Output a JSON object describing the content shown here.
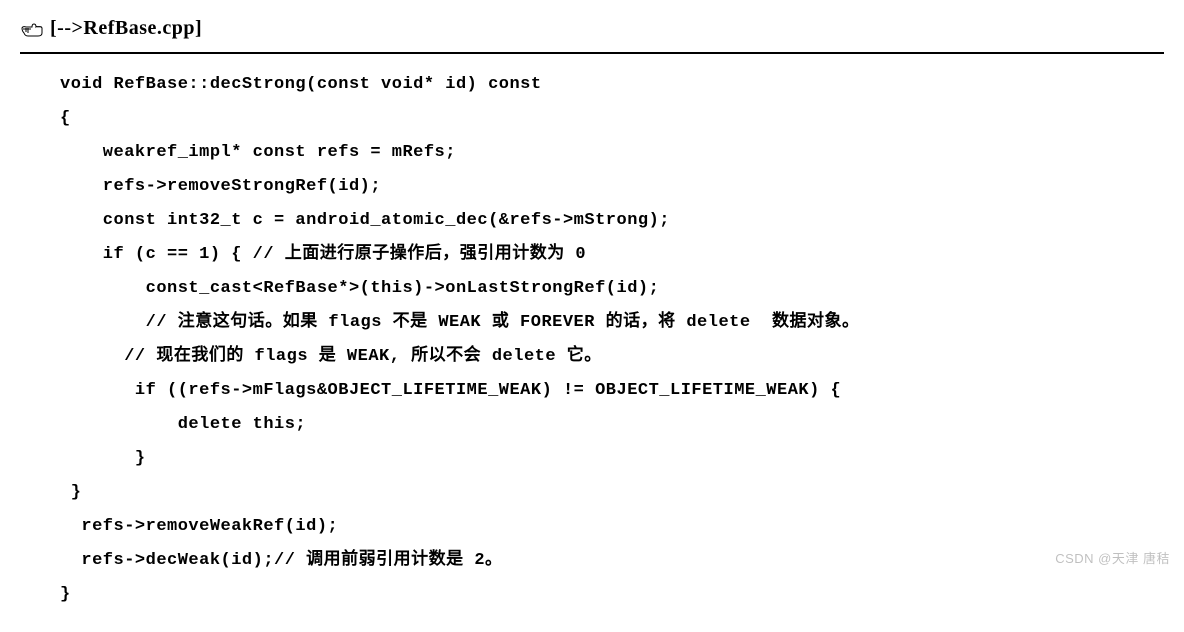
{
  "header": {
    "title": "[-->RefBase.cpp]"
  },
  "code": {
    "line1": "void RefBase::decStrong(const void* id) const",
    "line2": "{",
    "line3": "    weakref_impl* const refs = mRefs;",
    "line4": "    refs->removeStrongRef(id);",
    "line5": "    const int32_t c = android_atomic_dec(&refs->mStrong);",
    "line6": "    if (c == 1) { // 上面进行原子操作后，强引用计数为 0",
    "line7": "        const_cast<RefBase*>(this)->onLastStrongRef(id);",
    "line8": "        // 注意这句话。如果 flags 不是 WEAK 或 FOREVER 的话，将 delete  数据对象。",
    "line9": "      // 现在我们的 flags 是 WEAK, 所以不会 delete 它。",
    "line10": "       if ((refs->mFlags&OBJECT_LIFETIME_WEAK) != OBJECT_LIFETIME_WEAK) {",
    "line11": "           delete this;",
    "line12": "       }",
    "line13": " }",
    "line14": "  refs->removeWeakRef(id);",
    "line15": "  refs->decWeak(id);// 调用前弱引用计数是 2。",
    "line16": "}"
  },
  "watermark": "CSDN @天津 唐秸"
}
